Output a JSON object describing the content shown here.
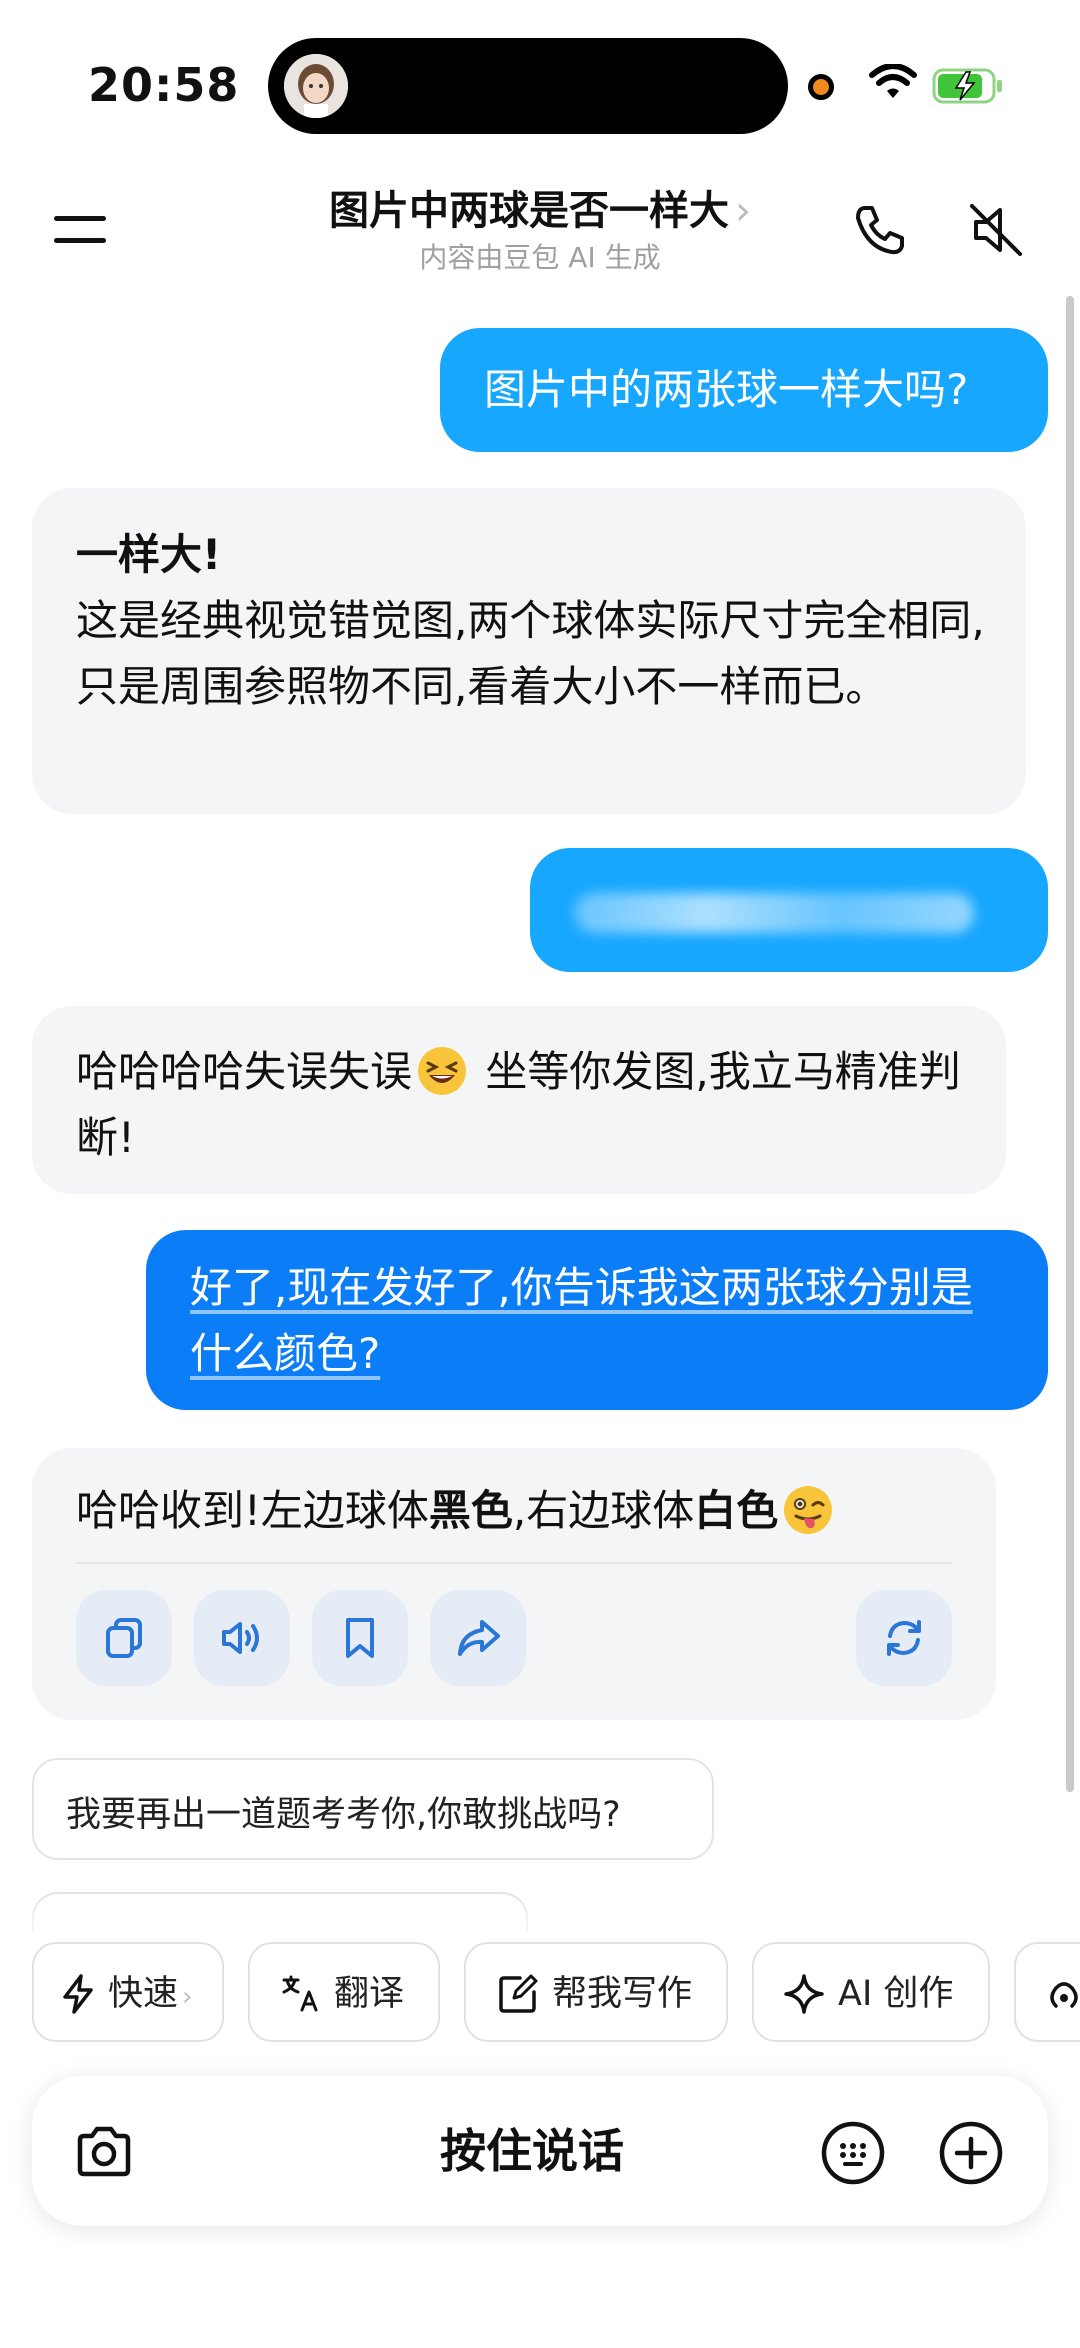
{
  "status_bar": {
    "time": "20:58",
    "icons": [
      "avatar-icon",
      "recording-dot",
      "wifi-icon",
      "battery-charging-icon"
    ]
  },
  "header": {
    "title": "图片中两球是否一样大",
    "title_chevron": "›",
    "subtitle": "内容由豆包 AI 生成",
    "icons": [
      "menu-icon",
      "phone-icon",
      "speaker-muted-icon"
    ]
  },
  "messages": [
    {
      "role": "user",
      "text": "图片中的两张球一样大吗?"
    },
    {
      "role": "assistant",
      "headline": "一样大!",
      "body": "这是经典视觉错觉图,两个球体实际尺寸完全相同,只是周围参照物不同,看着大小不一样而已。"
    },
    {
      "role": "user",
      "text": "。",
      "blurred": true
    },
    {
      "role": "assistant",
      "text_before": "哈哈哈哈失误失误",
      "emoji": "grinning-squinting-face",
      "text_after": "坐等你发图,我立马精准判断!"
    },
    {
      "role": "user",
      "text": "好了,现在发好了,你告诉我这两张球分别是什么颜色?"
    },
    {
      "role": "assistant",
      "part1": "哈哈收到!左边球体",
      "bold1": "黑色",
      "part2": ",右边球体",
      "bold2": "白色",
      "emoji": "winking-face-with-tongue"
    }
  ],
  "message_actions": [
    "copy-icon",
    "speaker-icon",
    "bookmark-icon",
    "share-icon",
    "regenerate-icon"
  ],
  "suggestions": [
    "我要再出一道题考考你,你敢挑战吗?"
  ],
  "toolbar": {
    "chips": [
      {
        "label": "快速",
        "icon": "lightning-icon",
        "chevron": "›"
      },
      {
        "label": "翻译",
        "icon": "translate-icon"
      },
      {
        "label": "帮我写作",
        "icon": "edit-icon"
      },
      {
        "label": "AI 创作",
        "icon": "sparkle-icon"
      },
      {
        "label": "",
        "icon": "broadcast-icon"
      }
    ]
  },
  "input": {
    "voice_label": "按住说话",
    "icons": [
      "camera-icon",
      "keyboard-icon",
      "plus-icon"
    ]
  },
  "colors": {
    "user_bubble": "#17a7ff",
    "user_bubble_alt": "#0a7df7",
    "assistant_bubble": "#f4f5f7",
    "action_button_bg": "#e6ecf5",
    "action_icon": "#2b77d8"
  }
}
